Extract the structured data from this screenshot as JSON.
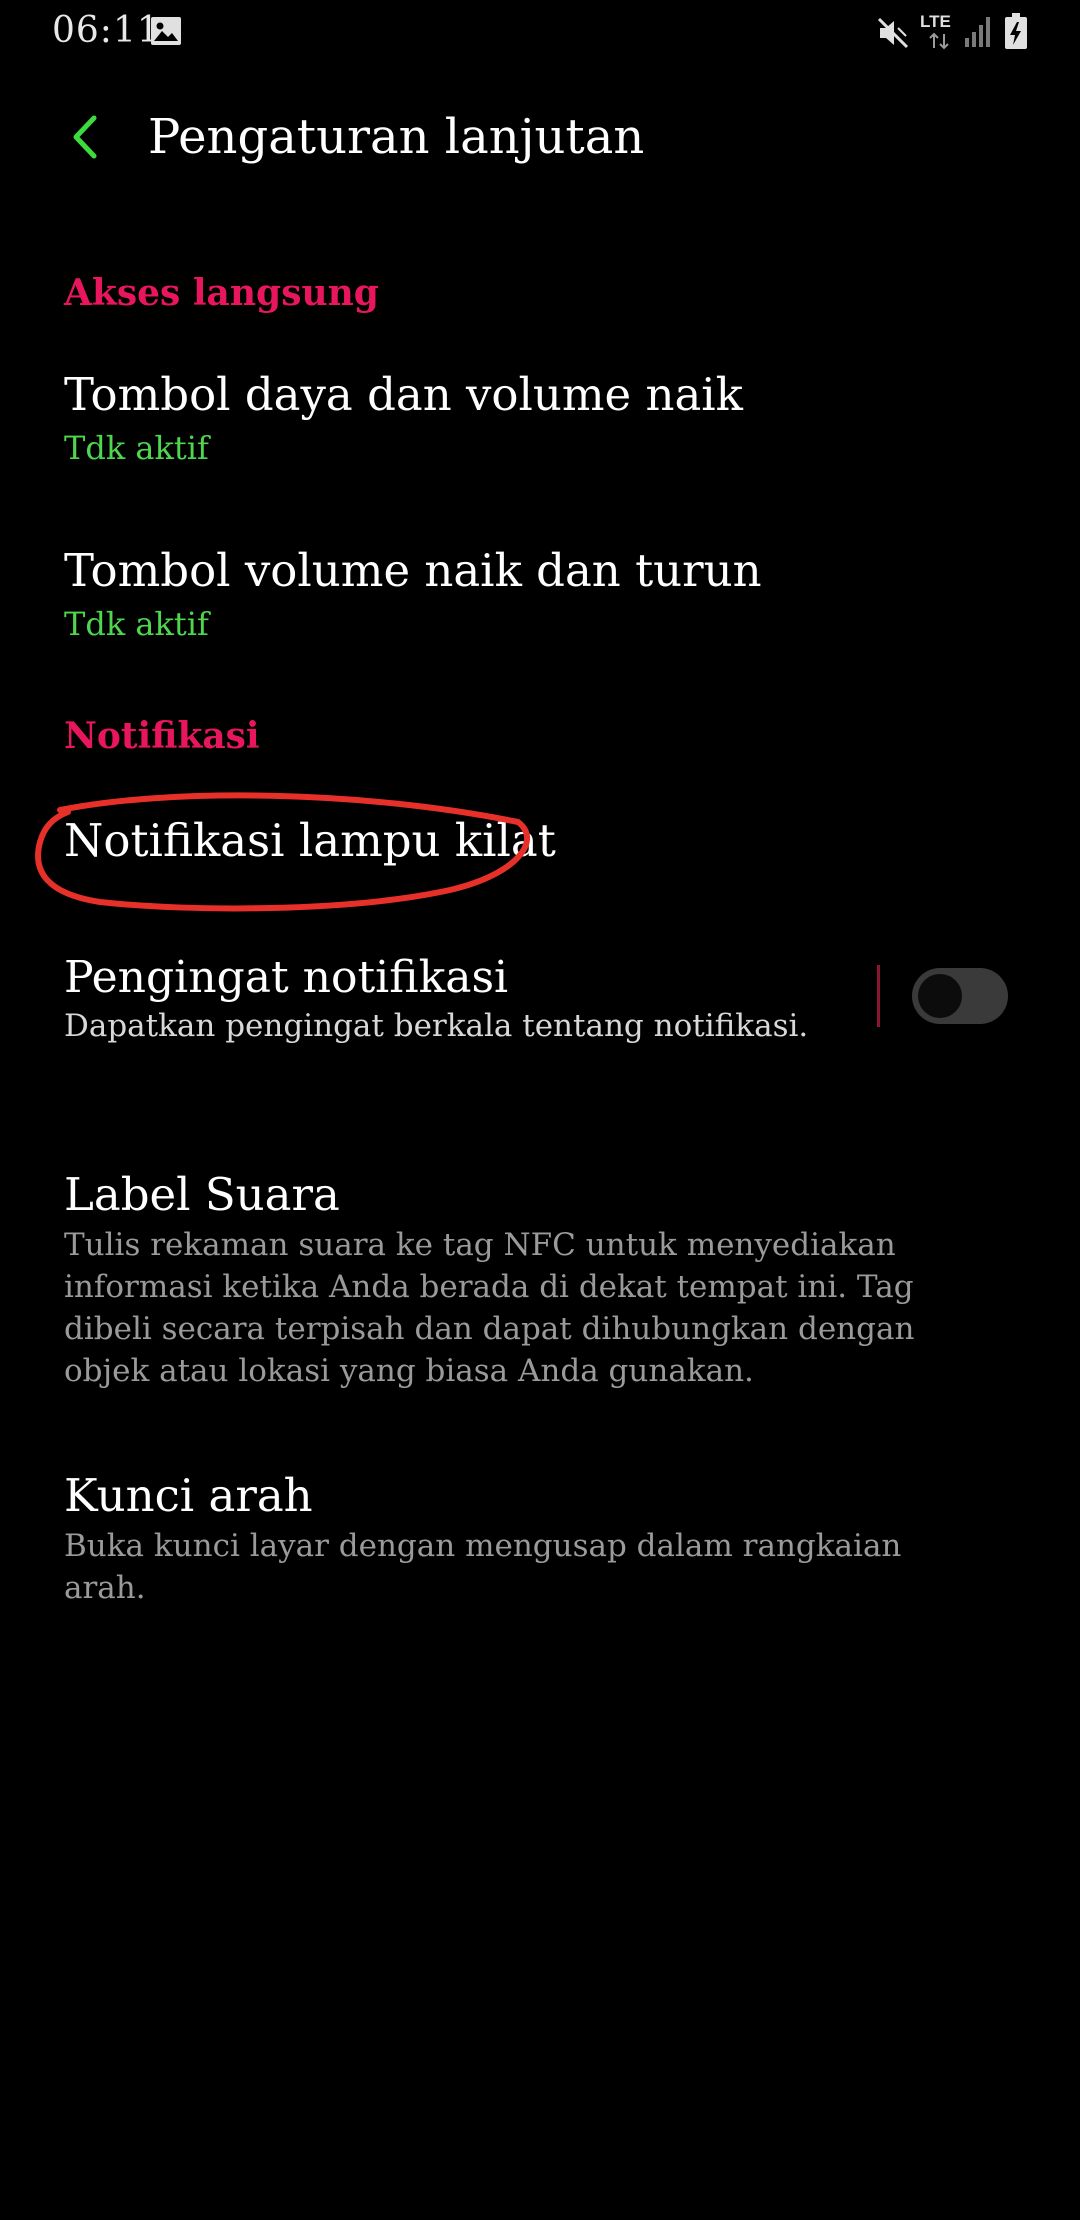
{
  "status_bar": {
    "time": "06:11",
    "network_type": "LTE",
    "icons": [
      "image-icon",
      "mute-icon",
      "lte-icon",
      "signal-icon",
      "battery-charging-icon"
    ]
  },
  "header": {
    "back_icon": "chevron-left-icon",
    "title": "Pengaturan lanjutan"
  },
  "sections": {
    "direct_access": {
      "header": "Akses langsung",
      "items": [
        {
          "title": "Tombol daya dan volume naik",
          "status": "Tdk aktif"
        },
        {
          "title": "Tombol volume naik dan turun",
          "status": "Tdk aktif"
        }
      ]
    },
    "notifications": {
      "header": "Notifikasi",
      "flash_notification": {
        "title": "Notifikasi lampu kilat"
      },
      "reminder": {
        "title": "Pengingat notifikasi",
        "description": "Dapatkan pengingat berkala tentang notifikasi.",
        "enabled": false
      }
    },
    "other": {
      "voice_label": {
        "title": "Label Suara",
        "description": "Tulis rekaman suara ke tag NFC untuk menyediakan informasi ketika Anda berada di dekat tempat ini. Tag dibeli secara terpisah dan dapat dihubungkan dengan objek atau lokasi yang biasa Anda gunakan."
      },
      "direction_lock": {
        "title": "Kunci arah",
        "description": "Buka kunci layar dengan mengusap dalam rangkaian arah."
      }
    }
  },
  "colors": {
    "background": "#000000",
    "section_header": "#e8175d",
    "status_green": "#4ed64e",
    "back_arrow": "#3ddc3d",
    "annotation": "#e8302a",
    "description_gray": "#9a9a9a"
  }
}
